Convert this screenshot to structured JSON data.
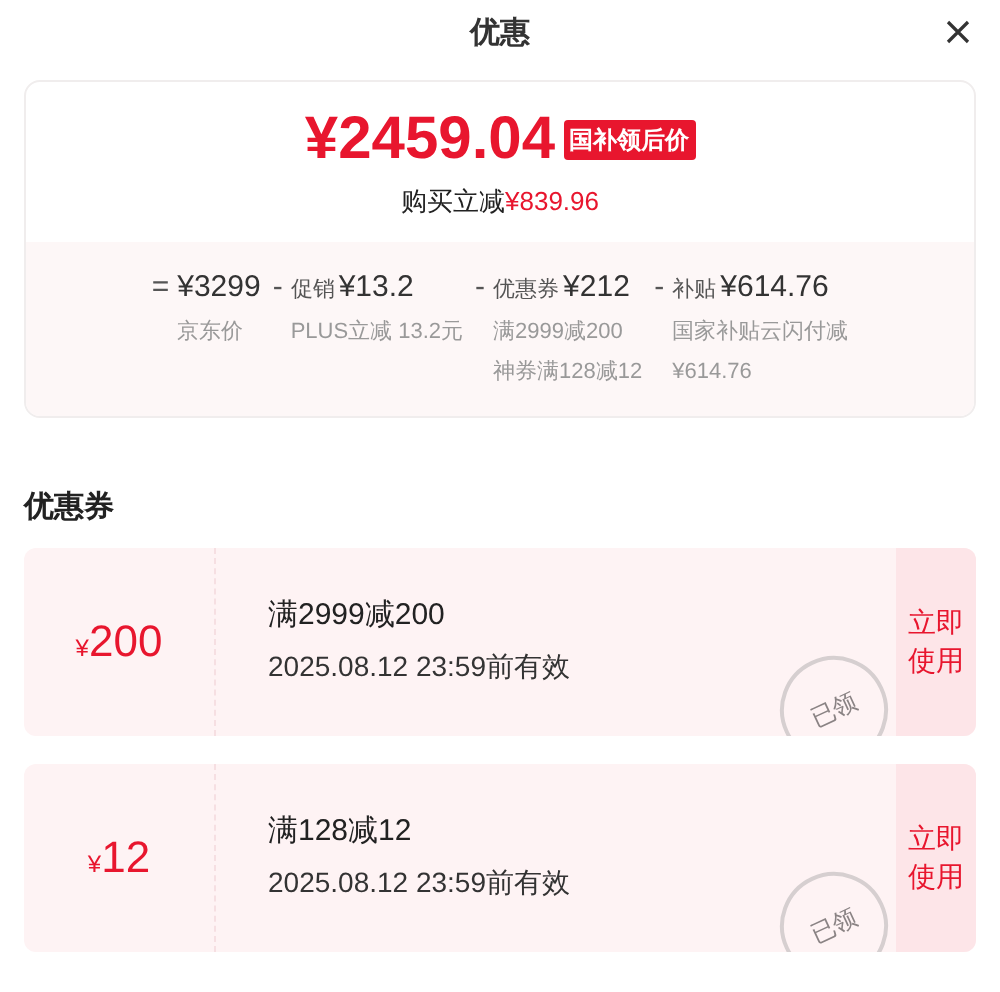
{
  "header": {
    "title": "优惠"
  },
  "summary": {
    "price": "¥2459.04",
    "badge": "国补领后价",
    "saving_label": "购买立减",
    "saving_value": "¥839.96",
    "breakdown": [
      {
        "operator": "=",
        "value": "¥3299",
        "notes": [
          "京东价"
        ]
      },
      {
        "operator": "-",
        "label": "促销",
        "value": "¥13.2",
        "notes": [
          "PLUS立减 13.2元"
        ]
      },
      {
        "operator": "-",
        "label": "优惠券",
        "value": "¥212",
        "notes": [
          "满2999减200",
          "神券满128减12"
        ]
      },
      {
        "operator": "-",
        "label": "补贴",
        "value": "¥614.76",
        "notes": [
          "国家补贴云闪付减",
          "¥614.76"
        ]
      }
    ]
  },
  "coupons_section": {
    "title": "优惠券",
    "coupons": [
      {
        "currency": "¥",
        "amount": "200",
        "condition": "满2999减200",
        "validity": "2025.08.12 23:59前有效",
        "stamp": "已领",
        "action": "立即使用"
      },
      {
        "currency": "¥",
        "amount": "12",
        "condition": "满128减12",
        "validity": "2025.08.12 23:59前有效",
        "stamp": "已领",
        "action": "立即使用"
      }
    ]
  }
}
